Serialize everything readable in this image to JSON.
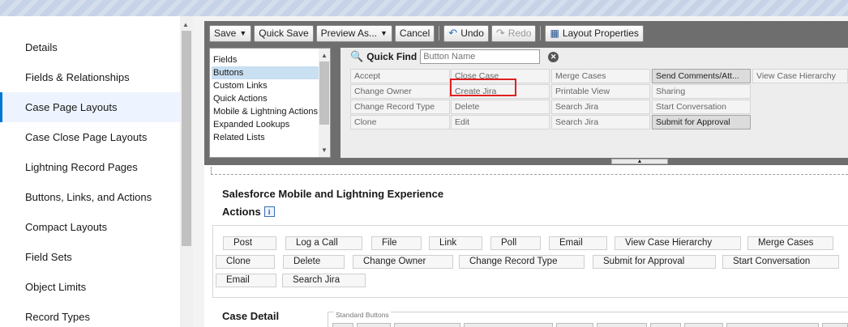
{
  "sidebar": {
    "items": [
      {
        "label": "Details"
      },
      {
        "label": "Fields & Relationships"
      },
      {
        "label": "Case Page Layouts",
        "active": true
      },
      {
        "label": "Case Close Page Layouts"
      },
      {
        "label": "Lightning Record Pages"
      },
      {
        "label": "Buttons, Links, and Actions"
      },
      {
        "label": "Compact Layouts"
      },
      {
        "label": "Field Sets"
      },
      {
        "label": "Object Limits"
      },
      {
        "label": "Record Types"
      }
    ]
  },
  "toolbar": {
    "save": "Save",
    "quick_save": "Quick Save",
    "preview_as": "Preview As...",
    "cancel": "Cancel",
    "undo": "Undo",
    "redo": "Redo",
    "layout_properties": "Layout Properties"
  },
  "palette": {
    "categories": [
      {
        "label": "Fields"
      },
      {
        "label": "Buttons",
        "selected": true
      },
      {
        "label": "Custom Links"
      },
      {
        "label": "Quick Actions"
      },
      {
        "label": "Mobile & Lightning Actions"
      },
      {
        "label": "Expanded Lookups"
      },
      {
        "label": "Related Lists"
      }
    ],
    "quick_find_label": "Quick Find",
    "quick_find_placeholder": "Button Name",
    "buttons": [
      {
        "label": "Accept",
        "used": false
      },
      {
        "label": "Close Case",
        "used": false
      },
      {
        "label": "Merge Cases",
        "used": false
      },
      {
        "label": "Send Comments/Att...",
        "used": true
      },
      {
        "label": "View Case Hierarchy",
        "used": false
      },
      {
        "label": "Change Owner",
        "used": false
      },
      {
        "label": "Create Jira",
        "used": false
      },
      {
        "label": "Printable View",
        "used": false
      },
      {
        "label": "Sharing",
        "used": false
      },
      {
        "label": "Change Record Type",
        "used": false
      },
      {
        "label": "Delete",
        "used": false
      },
      {
        "label": "Search Jira",
        "used": false
      },
      {
        "label": "Start Conversation",
        "used": false
      },
      {
        "label": "Clone",
        "used": false
      },
      {
        "label": "Edit",
        "used": false
      },
      {
        "label": "Search Jira",
        "used": false
      },
      {
        "label": "Submit for Approval",
        "used": true
      }
    ]
  },
  "layout": {
    "section_title": "Salesforce Mobile and Lightning Experience",
    "actions_label": "Actions",
    "info_icon": "i",
    "actions": [
      {
        "label": "Post"
      },
      {
        "label": "Log a Call"
      },
      {
        "label": "File"
      },
      {
        "label": "Link"
      },
      {
        "label": "Poll"
      },
      {
        "label": "Email"
      },
      {
        "label": "View Case Hierarchy"
      },
      {
        "label": "Merge Cases"
      },
      {
        "label": "Clone"
      },
      {
        "label": "Delete"
      },
      {
        "label": "Change Owner"
      },
      {
        "label": "Change Record Type"
      },
      {
        "label": "Submit for Approval"
      },
      {
        "label": "Start Conversation"
      },
      {
        "label": "Email"
      },
      {
        "label": "Search Jira"
      }
    ],
    "case_detail_title": "Case Detail",
    "standard_buttons_label": "Standard Buttons"
  },
  "colors": {
    "accent": "#0176d3",
    "highlight": "#e02020",
    "editor_frame": "#6e6e6e"
  }
}
